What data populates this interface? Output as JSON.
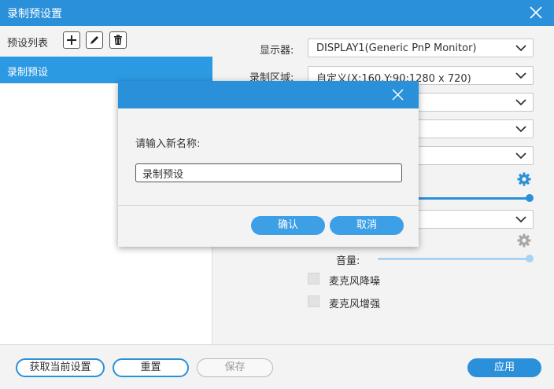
{
  "window": {
    "title": "录制预设置"
  },
  "presets": {
    "header_label": "预设列表",
    "tools": {
      "add_icon": "plus-icon",
      "edit_icon": "pencil-icon",
      "delete_icon": "trash-icon"
    },
    "items": [
      {
        "label": "录制预设",
        "selected": true
      }
    ]
  },
  "settings": {
    "display_label": "显示器:",
    "display_value": "DISPLAY1(Generic PnP Monitor)",
    "area_label": "录制区域:",
    "area_value": "自定义(X:160,Y:90;1280 x 720)",
    "volume_label": "音量:",
    "volume_level": 1.0,
    "mic_noise_label": "麦克风降噪",
    "mic_noise_checked": false,
    "mic_boost_label": "麦克风增强",
    "mic_boost_checked": false
  },
  "footer": {
    "get_current": "获取当前设置",
    "reset": "重置",
    "save": "保存",
    "apply": "应用"
  },
  "dialog": {
    "prompt": "请输入新名称:",
    "input_value": "录制预设",
    "confirm": "确认",
    "cancel": "取消"
  },
  "colors": {
    "accent": "#2a90d9",
    "selected": "#2c9ae2",
    "slider_light": "#a9d3f3"
  }
}
